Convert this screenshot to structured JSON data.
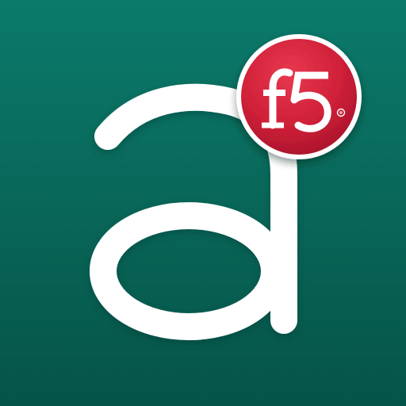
{
  "app_icon": {
    "letter": "a",
    "badge_brand": "f5",
    "registered_mark": "®"
  },
  "colors": {
    "background_top": "#0b7a6b",
    "background_bottom": "#055447",
    "letter": "#ffffff",
    "badge_top": "#e0324a",
    "badge_bottom": "#a8132b",
    "badge_logo": "#ffffff"
  }
}
